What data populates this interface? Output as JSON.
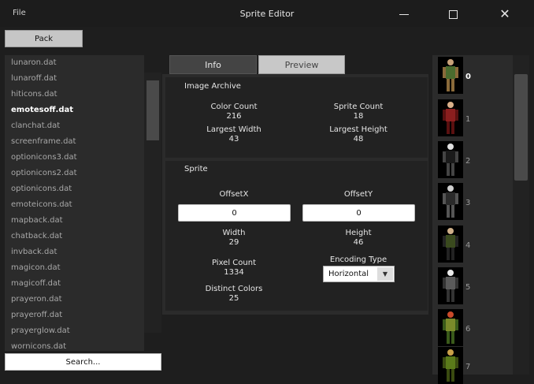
{
  "window": {
    "title": "Sprite Editor",
    "menu_file": "File"
  },
  "pack_button": "Pack",
  "file_list": [
    "lunaron.dat",
    "lunaroff.dat",
    "hiticons.dat",
    "emotesoff.dat",
    "clanchat.dat",
    "screenframe.dat",
    "optionicons3.dat",
    "optionicons2.dat",
    "optionicons.dat",
    "emoteicons.dat",
    "mapback.dat",
    "chatback.dat",
    "invback.dat",
    "magicon.dat",
    "magicoff.dat",
    "prayeron.dat",
    "prayeroff.dat",
    "prayerglow.dat",
    "wornicons.dat"
  ],
  "selected_file": "emotesoff.dat",
  "search_button": "Search...",
  "tabs": {
    "info": "Info",
    "preview": "Preview"
  },
  "image_archive": {
    "title": "Image Archive",
    "color_count_label": "Color Count",
    "color_count": "216",
    "sprite_count_label": "Sprite Count",
    "sprite_count": "18",
    "largest_width_label": "Largest Width",
    "largest_width": "43",
    "largest_height_label": "Largest Height",
    "largest_height": "48"
  },
  "sprite": {
    "title": "Sprite",
    "offset_x_label": "OffsetX",
    "offset_x": "0",
    "offset_y_label": "OffsetY",
    "offset_y": "0",
    "width_label": "Width",
    "width": "29",
    "height_label": "Height",
    "height": "46",
    "pixel_count_label": "Pixel Count",
    "pixel_count": "1334",
    "encoding_type_label": "Encoding Type",
    "encoding_type": "Horizontal",
    "distinct_colors_label": "Distinct Colors",
    "distinct_colors": "25"
  },
  "sprite_indices": [
    "0",
    "1",
    "2",
    "3",
    "4",
    "5",
    "6",
    "7"
  ],
  "colors": {
    "accent_selected": "#ffffff",
    "panel": "#2b2b2b",
    "background": "#1e1e1e"
  }
}
